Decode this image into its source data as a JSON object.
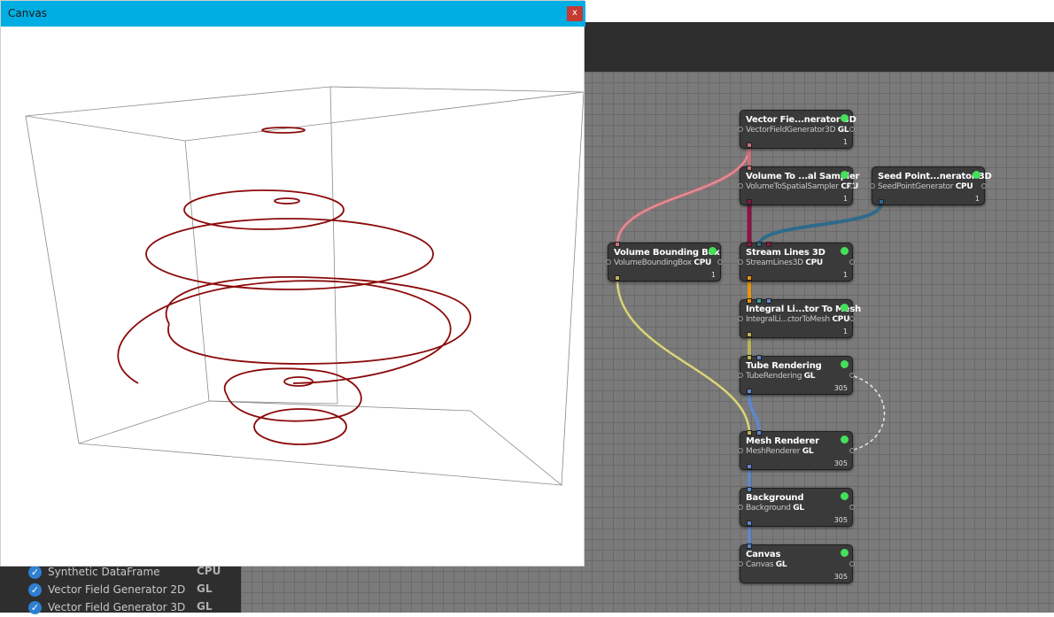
{
  "canvas_window": {
    "title": "Canvas",
    "close_label": "x"
  },
  "processor_list": [
    {
      "name": "Synthetic DataFrame",
      "tag": "CPU"
    },
    {
      "name": "Vector Field Generator 2D",
      "tag": "GL"
    },
    {
      "name": "Vector Field Generator 3D",
      "tag": "GL"
    }
  ],
  "nodes": {
    "vfg3d": {
      "title": "Vector Fie...nerator 3D",
      "class": "VectorFieldGenerator3D",
      "tag": "GL",
      "count": "1"
    },
    "vtss": {
      "title": "Volume To ...al Sampler",
      "class": "VolumeToSpatialSampler",
      "tag": "CPU",
      "count": "1"
    },
    "spg3d": {
      "title": "Seed Point...nerator 3D",
      "class": "SeedPointGenerator",
      "tag": "CPU",
      "count": "1"
    },
    "vbb": {
      "title": "Volume Bounding Box",
      "class": "VolumeBoundingBox",
      "tag": "CPU",
      "count": "1"
    },
    "sl3d": {
      "title": "Stream Lines 3D",
      "class": "StreamLines3D",
      "tag": "CPU",
      "count": "1"
    },
    "iltm": {
      "title": "Integral Li...tor To Mesh",
      "class": "IntegralLi...ctorToMesh",
      "tag": "CPU",
      "count": "1"
    },
    "tube": {
      "title": "Tube Rendering",
      "class": "TubeRendering",
      "tag": "GL",
      "count": "305"
    },
    "mesh": {
      "title": "Mesh Renderer",
      "class": "MeshRenderer",
      "tag": "GL",
      "count": "305"
    },
    "bg": {
      "title": "Background",
      "class": "Background",
      "tag": "GL",
      "count": "305"
    },
    "canvas": {
      "title": "Canvas",
      "class": "Canvas",
      "tag": "GL",
      "count": "305"
    }
  },
  "colors": {
    "titlebar": "#00aee3",
    "close": "#c53a32",
    "status_ok": "#44e05a",
    "streamline": "#8b0a0a",
    "wire_volume": "#c9707a",
    "wire_sampler": "#8e1445",
    "wire_seed": "#2f6a8a",
    "wire_geometry": "#b9b45a",
    "wire_mesh": "#e8930c",
    "wire_image": "#5f86c8"
  }
}
